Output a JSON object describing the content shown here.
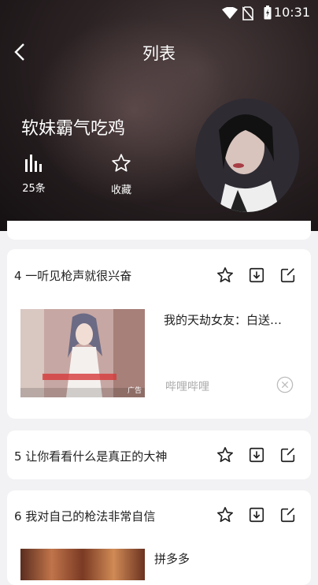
{
  "status": {
    "time": "10:31"
  },
  "header": {
    "title": "列表",
    "user_name": "软妹霸气吃鸡"
  },
  "stats": {
    "count_label": "25条",
    "fav_label": "收藏"
  },
  "items": [
    {
      "index_title": "4 一听见枪声就很兴奋",
      "ad": {
        "title": "我的天劫女友：白送…",
        "source": "哔哩哔哩",
        "thumb_caption": "广告"
      }
    },
    {
      "index_title": "5 让你看看什么是真正的大神"
    },
    {
      "index_title": "6 我对自己的枪法非常自信",
      "ad": {
        "title": "拼多多"
      }
    }
  ]
}
